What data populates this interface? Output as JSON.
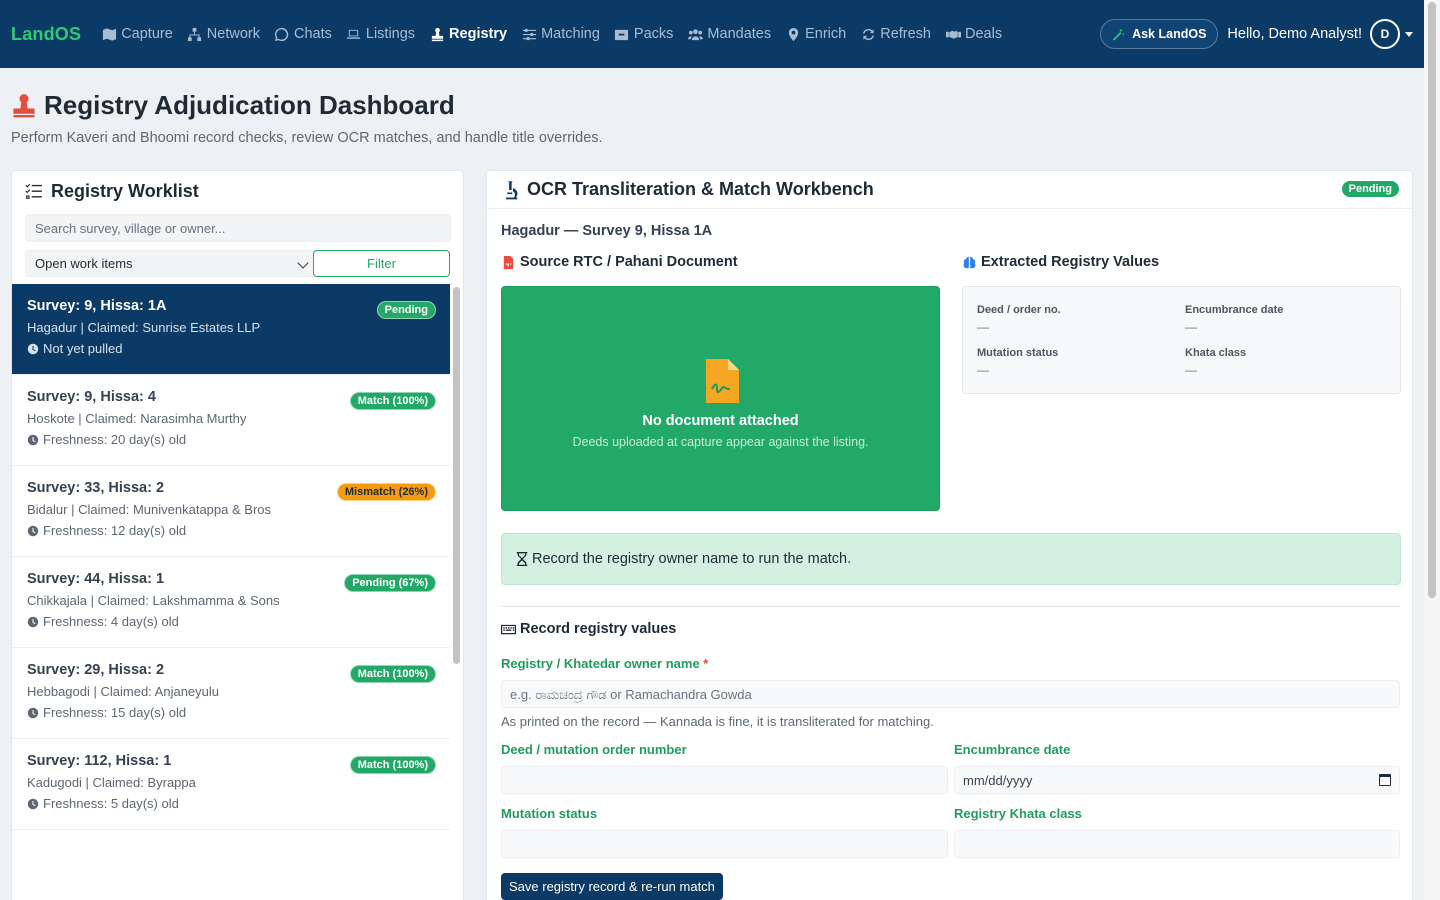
{
  "navbar": {
    "brand": "LandOS",
    "items": [
      {
        "label": "Capture",
        "icon": "map-icon"
      },
      {
        "label": "Network",
        "icon": "network-icon"
      },
      {
        "label": "Chats",
        "icon": "whatsapp-icon"
      },
      {
        "label": "Listings",
        "icon": "laptop-icon"
      },
      {
        "label": "Registry",
        "icon": "stamp-icon",
        "active": true
      },
      {
        "label": "Matching",
        "icon": "sliders-icon"
      },
      {
        "label": "Packs",
        "icon": "box-icon"
      },
      {
        "label": "Mandates",
        "icon": "users-icon"
      },
      {
        "label": "Enrich",
        "icon": "map-pin-icon"
      },
      {
        "label": "Refresh",
        "icon": "refresh-icon"
      },
      {
        "label": "Deals",
        "icon": "handshake-icon"
      }
    ],
    "ask_label": "Ask LandOS",
    "greeting": "Hello, Demo Analyst!",
    "avatar_initial": "D"
  },
  "header": {
    "title": "Registry Adjudication Dashboard",
    "subtitle": "Perform Kaveri and Bhoomi record checks, review OCR matches, and handle title overrides."
  },
  "worklist": {
    "title": "Registry Worklist",
    "search_placeholder": "Search survey, village or owner...",
    "select_value": "Open work items",
    "filter_label": "Filter",
    "items": [
      {
        "title": "Survey: 9, Hissa: 1A",
        "sub": "Hagadur | Claimed: Sunrise Estates LLP",
        "fresh": "Not yet pulled",
        "badge": "Pending",
        "badge_color": "green"
      },
      {
        "title": "Survey: 9, Hissa: 4",
        "sub": "Hoskote | Claimed: Narasimha Murthy",
        "fresh": "Freshness: 20 day(s) old",
        "badge": "Match (100%)",
        "badge_color": "green"
      },
      {
        "title": "Survey: 33, Hissa: 2",
        "sub": "Bidalur | Claimed: Munivenkatappa & Bros",
        "fresh": "Freshness: 12 day(s) old",
        "badge": "Mismatch (26%)",
        "badge_color": "orange"
      },
      {
        "title": "Survey: 44, Hissa: 1",
        "sub": "Chikkajala | Claimed: Lakshmamma & Sons",
        "fresh": "Freshness: 4 day(s) old",
        "badge": "Pending (67%)",
        "badge_color": "green"
      },
      {
        "title": "Survey: 29, Hissa: 2",
        "sub": "Hebbagodi | Claimed: Anjaneyulu",
        "fresh": "Freshness: 15 day(s) old",
        "badge": "Match (100%)",
        "badge_color": "green"
      },
      {
        "title": "Survey: 112, Hissa: 1",
        "sub": "Kadugodi | Claimed: Byrappa",
        "fresh": "Freshness: 5 day(s) old",
        "badge": "Match (100%)",
        "badge_color": "green"
      }
    ]
  },
  "workbench": {
    "title": "OCR Transliteration & Match Workbench",
    "status_badge": "Pending",
    "location": "Hagadur — Survey 9, Hissa 1A",
    "source_title": "Source RTC / Pahani Document",
    "no_doc_title": "No document attached",
    "no_doc_desc": "Deeds uploaded at capture appear against the listing.",
    "extracted_title": "Extracted Registry Values",
    "extracted": {
      "deed_label": "Deed / order no.",
      "deed_value": "—",
      "encumbrance_label": "Encumbrance date",
      "encumbrance_value": "—",
      "mutation_label": "Mutation status",
      "mutation_value": "—",
      "khata_label": "Khata class",
      "khata_value": "—"
    },
    "alert_text": "Record the registry owner name to run the match.",
    "form": {
      "title": "Record registry values",
      "owner_label": "Registry / Khatedar owner name",
      "owner_required": "*",
      "owner_placeholder": "e.g. ರಾಮಚಂದ್ರ ಗೌಡ or Ramachandra Gowda",
      "owner_help": "As printed on the record — Kannada is fine, it is transliterated for matching.",
      "deed_label": "Deed / mutation order number",
      "encumbrance_label": "Encumbrance date",
      "encumbrance_placeholder": "mm/dd/yyyy",
      "mutation_label": "Mutation status",
      "khata_label": "Registry Khata class",
      "save_label": "Save registry record & re-run match"
    }
  },
  "colors": {
    "navbar": "#0c3a66",
    "brand": "#2ecc71",
    "accent_green": "#22a867",
    "warning_orange": "#f39c12",
    "title_icon_red": "#e74c3c"
  }
}
